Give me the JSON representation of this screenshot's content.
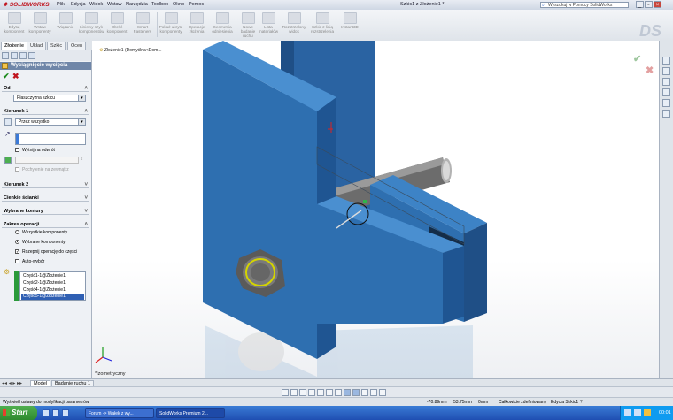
{
  "app": {
    "logo_text": "SOLIDWORKS",
    "menus": [
      "Plik",
      "Edycja",
      "Widok",
      "Wstaw",
      "Narzędzia",
      "Toolbox",
      "Okno",
      "Pomoc"
    ],
    "document_title": "Szkic1 z Złożenie1 *",
    "help_search_placeholder": "Wyszukuj w Pomocy SolidWorks"
  },
  "toolbar": {
    "tools": [
      {
        "label": "Edytuj komponent",
        "icon": "edit-component-icon"
      },
      {
        "label": "Wstaw komponenty",
        "icon": "insert-components-icon"
      },
      {
        "label": "Wiązanie",
        "icon": "mate-icon"
      },
      {
        "label": "Liniowy szyk komponentów",
        "icon": "linear-pattern-icon"
      },
      {
        "label": "Obróć komponent",
        "icon": "rotate-component-icon"
      },
      {
        "label": "Smart Fasteners",
        "icon": "fastener-icon"
      },
      {
        "label": "Pokaż ukryte komponenty",
        "icon": "show-hidden-icon"
      },
      {
        "label": "Operacje złożenia",
        "icon": "assembly-features-icon"
      },
      {
        "label": "Geometria odniesienia",
        "icon": "reference-geometry-icon"
      },
      {
        "label": "Nowe badanie ruchu",
        "icon": "motion-study-icon"
      },
      {
        "label": "Lista materiałów",
        "icon": "bom-icon"
      },
      {
        "label": "Rozstrzelony widok",
        "icon": "exploded-view-icon"
      },
      {
        "label": "Szkic z linią rozstrzelenia",
        "icon": "explode-line-icon"
      },
      {
        "label": "Instant3D",
        "icon": "instant3d-icon"
      }
    ]
  },
  "panel": {
    "tabs": [
      "Złożenie",
      "Układ",
      "Szkic",
      "Ocen"
    ],
    "active_tab": "Złożenie",
    "feature_title": "Wyciągnięcie wycięcia",
    "from_group": "Od",
    "from_value": "Płaszczyzna szkicu",
    "direction1_group": "Kierunek 1",
    "direction1_value": "Przez wszystko",
    "flip_side_label": "Wytnij na odwrót",
    "draft_outward_label": "Pochylenie na zewnątrz",
    "direction2_group": "Kierunek 2",
    "thin_feature_group": "Cienkie ścianki",
    "selected_contours_group": "Wybrane kontury",
    "feature_scope_group": "Zakres operacji",
    "scope_all_label": "Wszystkie komponenty",
    "scope_selected_label": "Wybrane komponenty",
    "propagate_label": "Rozepnij operację do części",
    "auto_select_label": "Auto-wybór",
    "components": [
      "Część1-1@Złożenie1",
      "Część2-1@Złożenie1",
      "Część4-1@Złożenie1",
      "Część5-1@Złożenie1"
    ],
    "selected_component_index": 3
  },
  "viewport": {
    "tree_root": "Złożenie1 (Domyślna<Dom...",
    "view_label": "*Izometryczny"
  },
  "bottom_tabs": [
    "Model",
    "Badanie ruchu 1"
  ],
  "status": {
    "hint": "Wyświetl ustawy do modyfikacji parametrów",
    "x": "-70.89mm",
    "y": "53.75mm",
    "z": "0mm",
    "state": "Całkowicie zdefiniowany",
    "edit": "Edycja Szkic1"
  },
  "taskbar": {
    "start_label": "Start",
    "windows": [
      {
        "label": "Forum -> Wałek z wy...",
        "active": false
      },
      {
        "label": "SolidWorks Premium 2...",
        "active": true
      }
    ],
    "clock": "00:01"
  },
  "colors": {
    "part_blue": "#2e6fb0",
    "selection_blue": "#2f5fb3",
    "accept_green": "#1a8a1a",
    "cancel_red": "#c0141e"
  }
}
